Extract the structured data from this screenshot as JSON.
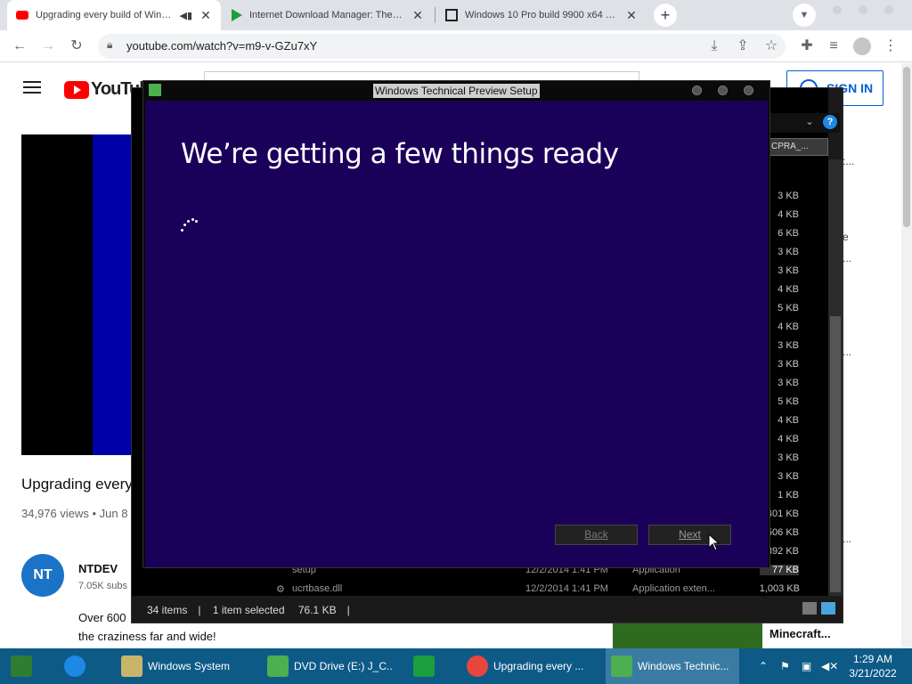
{
  "browser": {
    "tabs": [
      {
        "title": "Upgrading every build of Window",
        "active": true
      },
      {
        "title": "Internet Download Manager: The faste",
        "active": false
      },
      {
        "title": "Windows 10 Pro build 9900 x64 (Techn",
        "active": false
      }
    ],
    "new_tab_label": "+",
    "url": "youtube.com/watch?v=m9-v-GZu7xY"
  },
  "youtube": {
    "logo_text": "YouTube",
    "signin_label": "SIGN IN",
    "video_title": "Upgrading every",
    "video_meta": "34,976 views • Jun 8",
    "channel_initials": "NT",
    "channel_name": "NTDEV",
    "channel_subs": "7.05K subs",
    "description_line1": "Over 600",
    "description_line2": "the craziness far and wide!",
    "rec_title": "Minecraft..."
  },
  "explorer": {
    "search_text": "CPRA_...",
    "sizes": [
      "3 KB",
      "4 KB",
      "6 KB",
      "3 KB",
      "3 KB",
      "4 KB",
      "5 KB",
      "4 KB",
      "3 KB",
      "3 KB",
      "3 KB",
      "5 KB",
      "4 KB",
      "4 KB",
      "3 KB",
      "3 KB",
      "1 KB",
      "401 KB",
      "506 KB",
      "892 KB",
      "77 KB",
      "1,003 KB"
    ],
    "row1": {
      "name": "setup",
      "date": "12/2/2014 1:41 PM",
      "type": "Application"
    },
    "row2": {
      "name": "ucrtbase.dll",
      "date": "12/2/2014 1:41 PM",
      "type": "Application exten..."
    },
    "status_items": "34 items",
    "status_selected": "1 item selected",
    "status_size": "76.1 KB"
  },
  "setup_dialog": {
    "window_title": "Windows Technical Preview Setup",
    "heading": "We’re getting a few things ready",
    "back_label": "Back",
    "next_label": "Next"
  },
  "taskbar": {
    "items": [
      {
        "label": "Windows System"
      },
      {
        "label": "DVD Drive (E:) J_C..."
      },
      {
        "label": "Upgrading every ..."
      },
      {
        "label": "Windows Technic..."
      }
    ],
    "time": "1:29 AM",
    "date": "3/21/2022"
  }
}
